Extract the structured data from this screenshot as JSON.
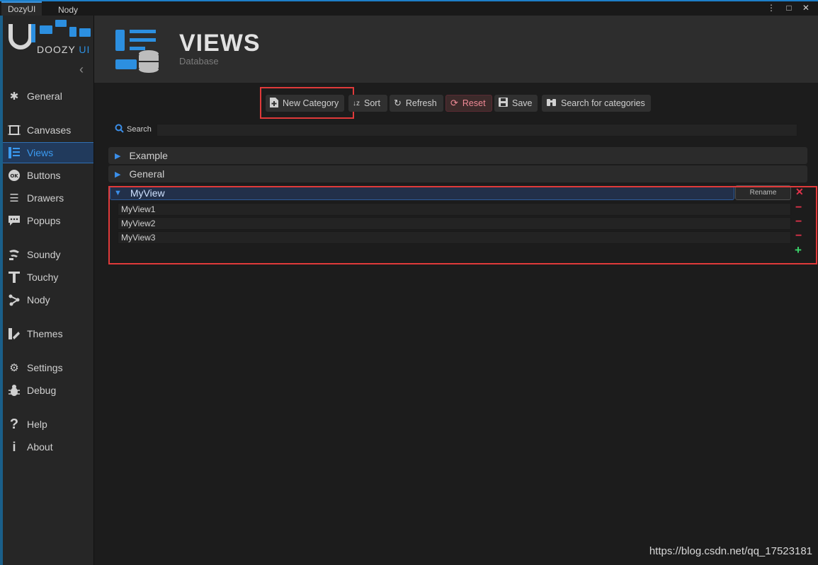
{
  "tabs": [
    {
      "label": "DozyUI"
    },
    {
      "label": "Nody"
    }
  ],
  "window_icons": "⋮ □ ✕",
  "logo": {
    "brand": "DOOZY",
    "ui": "UI"
  },
  "sidebar": {
    "items": [
      {
        "label": "General",
        "icon": "general-icon"
      },
      {
        "label": "Canvases",
        "icon": "canvas-icon"
      },
      {
        "label": "Views",
        "icon": "views-icon",
        "active": true
      },
      {
        "label": "Buttons",
        "icon": "ok-button-icon"
      },
      {
        "label": "Drawers",
        "icon": "drawers-icon"
      },
      {
        "label": "Popups",
        "icon": "popup-icon"
      },
      {
        "label": "Soundy",
        "icon": "sound-icon"
      },
      {
        "label": "Touchy",
        "icon": "touch-icon"
      },
      {
        "label": "Nody",
        "icon": "nody-icon"
      },
      {
        "label": "Themes",
        "icon": "themes-icon"
      },
      {
        "label": "Settings",
        "icon": "gear-icon"
      },
      {
        "label": "Debug",
        "icon": "bug-icon"
      },
      {
        "label": "Help",
        "icon": "help-icon"
      },
      {
        "label": "About",
        "icon": "info-icon"
      }
    ]
  },
  "header": {
    "title": "VIEWS",
    "subtitle": "Database"
  },
  "toolbar": {
    "new_category": "New Category",
    "sort": "Sort",
    "refresh": "Refresh",
    "reset": "Reset",
    "save": "Save",
    "search_categories": "Search for categories"
  },
  "search": {
    "label": "Search",
    "value": ""
  },
  "categories": [
    {
      "name": "Example",
      "expanded": false
    },
    {
      "name": "General",
      "expanded": false
    },
    {
      "name": "MyView",
      "expanded": true,
      "rename_label": "Rename",
      "items": [
        "MyView1",
        "MyView2",
        "MyView3"
      ]
    }
  ],
  "watermark": "https://blog.csdn.net/qq_17523181",
  "colors": {
    "accent": "#2c8fe0",
    "highlight": "#e03a3a",
    "delete": "#e0324a",
    "add": "#3ad46a"
  }
}
